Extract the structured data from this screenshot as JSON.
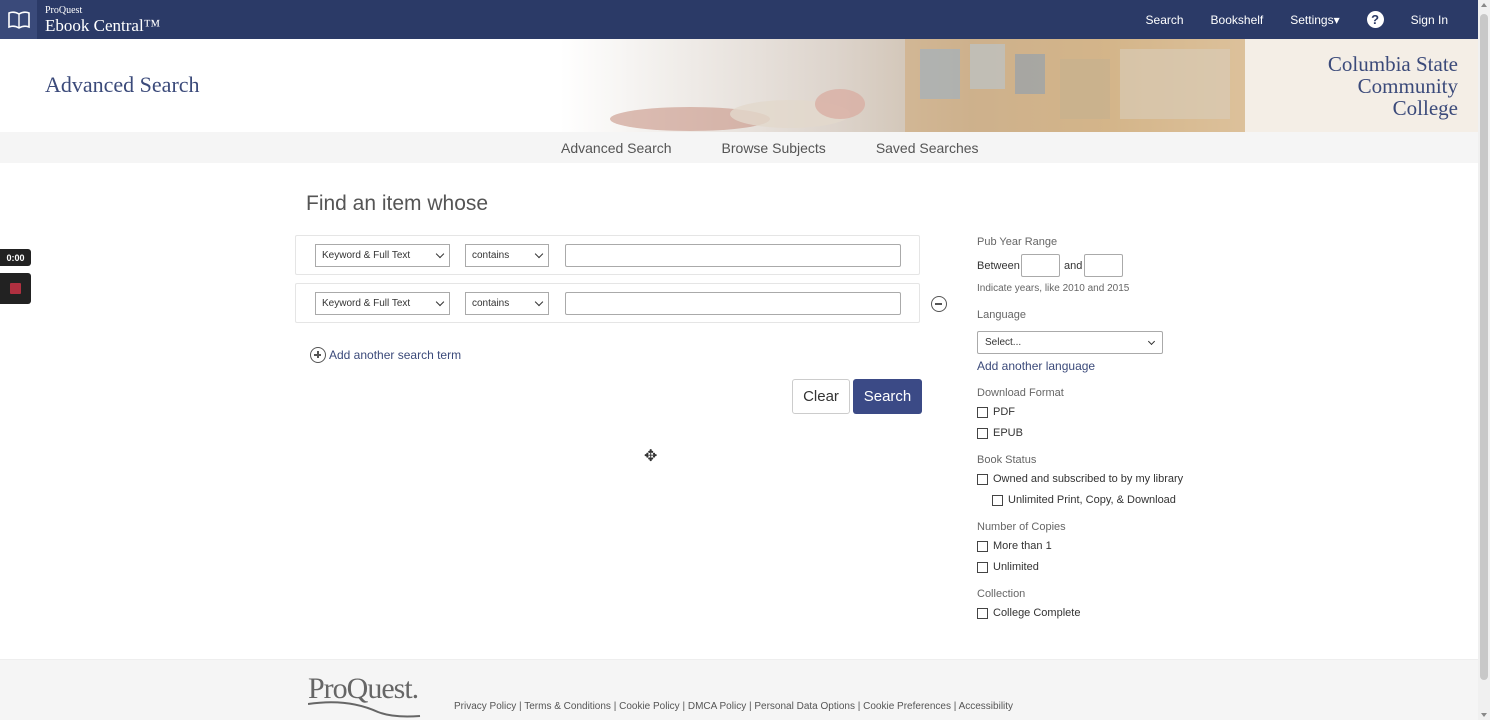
{
  "header": {
    "logo_small": "ProQuest",
    "logo_big": "Ebook Central™",
    "nav": [
      "Search",
      "Bookshelf",
      "Settings▾",
      "Sign In"
    ],
    "help_icon": "?"
  },
  "banner": {
    "title": "Advanced Search",
    "college_lines": [
      "Columbia State",
      "Community",
      "College"
    ]
  },
  "subnav": {
    "tabs": [
      "Advanced Search",
      "Browse Subjects",
      "Saved Searches"
    ],
    "active": "Advanced Search"
  },
  "search": {
    "heading": "Find an item whose",
    "rows": [
      {
        "field": "Keyword & Full Text",
        "operator": "contains",
        "value": ""
      },
      {
        "field": "Keyword & Full Text",
        "operator": "contains",
        "value": ""
      }
    ],
    "add_term_label": "Add another search term",
    "clear_label": "Clear",
    "search_label": "Search"
  },
  "recorder": {
    "timer": "0:00"
  },
  "filters": {
    "pub_year_label": "Pub Year Range",
    "between_label": "Between",
    "and_label": "and",
    "year_hint": "Indicate years, like 2010 and 2015",
    "language_label": "Language",
    "language_placeholder": "Select...",
    "add_language": "Add another language",
    "download_label": "Download Format",
    "download_options": [
      "PDF",
      "EPUB"
    ],
    "status_label": "Book Status",
    "status_options": [
      "Owned and subscribed to by my library",
      "Unlimited Print, Copy, & Download"
    ],
    "copies_label": "Number of Copies",
    "copies_options": [
      "More than 1",
      "Unlimited"
    ],
    "collection_label": "Collection",
    "collection_options": [
      "College Complete"
    ]
  },
  "footer": {
    "logo": "ProQuest.",
    "links": [
      "Privacy Policy",
      "Terms & Conditions",
      "Cookie Policy",
      "DMCA Policy",
      "Personal Data Options",
      "Cookie Preferences",
      "Accessibility"
    ]
  }
}
